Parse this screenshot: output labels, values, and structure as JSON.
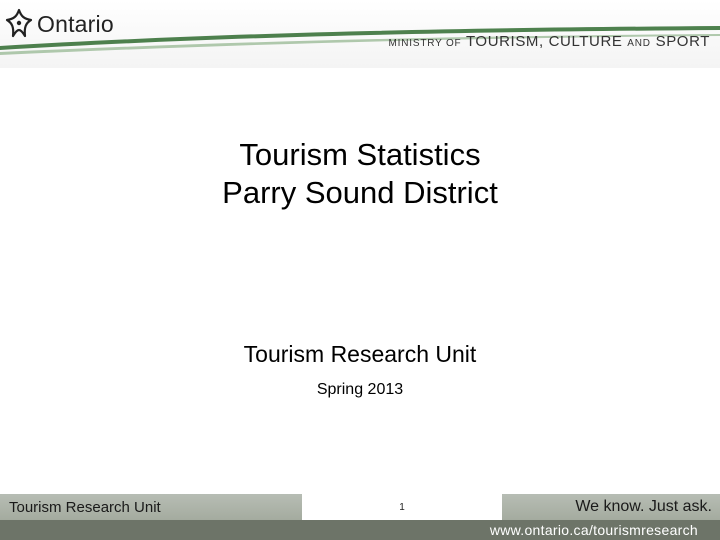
{
  "header": {
    "logo_text": "Ontario",
    "ministry_prefix": "MINISTRY OF",
    "ministry_tourism": "TOURISM,",
    "ministry_culture": "CULTURE",
    "ministry_and": "AND",
    "ministry_sport": "SPORT"
  },
  "slide": {
    "title_line1": "Tourism Statistics",
    "title_line2": "Parry Sound District",
    "subtitle": "Tourism Research Unit",
    "date": "Spring 2013"
  },
  "footer": {
    "left_text": "Tourism Research Unit",
    "page_number": "1",
    "tagline": "We know. Just ask.",
    "url": "www.ontario.ca/tourismresearch"
  },
  "colors": {
    "footer_band": "#aab0a5",
    "url_band": "#6d7468",
    "swoosh": "#2f6b2f"
  }
}
